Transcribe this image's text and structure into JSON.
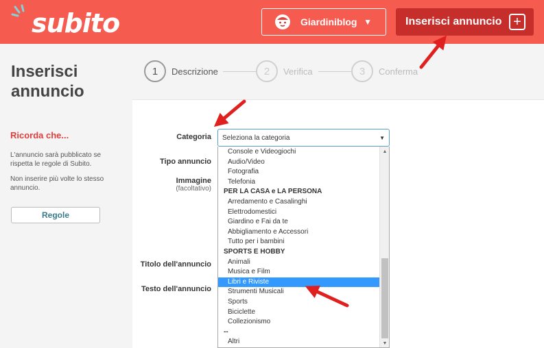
{
  "header": {
    "logo_text": "subito",
    "user_name": "Giardiniblog",
    "post_label": "Inserisci annuncio"
  },
  "sidebar": {
    "title_line1": "Inserisci",
    "title_line2": "annuncio",
    "remember": "Ricorda che...",
    "info1": "L'annuncio sarà pubblicato se rispetta le regole di Subito.",
    "info2": "Non inserire più volte lo stesso annuncio.",
    "rules_label": "Regole"
  },
  "steps": [
    {
      "num": "1",
      "label": "Descrizione"
    },
    {
      "num": "2",
      "label": "Verifica"
    },
    {
      "num": "3",
      "label": "Conferma"
    }
  ],
  "form": {
    "category_label": "Categoria",
    "type_label": "Tipo annuncio",
    "image_label": "Immagine",
    "image_sub": "(facoltativo)",
    "title_label": "Titolo dell'annuncio",
    "text_label": "Testo dell'annuncio",
    "select_placeholder": "Seleziona la categoria"
  },
  "dropdown_options": [
    {
      "label": "Console e Videogiochi",
      "group": false,
      "selected": false
    },
    {
      "label": "Audio/Video",
      "group": false,
      "selected": false
    },
    {
      "label": "Fotografia",
      "group": false,
      "selected": false
    },
    {
      "label": "Telefonia",
      "group": false,
      "selected": false
    },
    {
      "label": "PER LA CASA e LA PERSONA",
      "group": true,
      "selected": false
    },
    {
      "label": "Arredamento e Casalinghi",
      "group": false,
      "selected": false
    },
    {
      "label": "Elettrodomestici",
      "group": false,
      "selected": false
    },
    {
      "label": "Giardino e Fai da te",
      "group": false,
      "selected": false
    },
    {
      "label": "Abbigliamento e Accessori",
      "group": false,
      "selected": false
    },
    {
      "label": "Tutto per i bambini",
      "group": false,
      "selected": false
    },
    {
      "label": "SPORTS E HOBBY",
      "group": true,
      "selected": false
    },
    {
      "label": "Animali",
      "group": false,
      "selected": false
    },
    {
      "label": "Musica e Film",
      "group": false,
      "selected": false
    },
    {
      "label": "Libri e Riviste",
      "group": false,
      "selected": true
    },
    {
      "label": "Strumenti Musicali",
      "group": false,
      "selected": false
    },
    {
      "label": "Sports",
      "group": false,
      "selected": false
    },
    {
      "label": "Biciclette",
      "group": false,
      "selected": false
    },
    {
      "label": "Collezionismo",
      "group": false,
      "selected": false
    },
    {
      "label": "--",
      "group": true,
      "selected": false
    },
    {
      "label": "Altri",
      "group": false,
      "selected": false
    }
  ],
  "colors": {
    "brand": "#f55b4f",
    "post_button": "#c62e2c",
    "selection": "#3399ff",
    "arrow": "#e0201e"
  },
  "icons": {
    "avatar": "baby-face-icon",
    "chevron": "chevron-down-icon",
    "plus": "plus-icon",
    "select_arrow": "caret-down-icon"
  }
}
